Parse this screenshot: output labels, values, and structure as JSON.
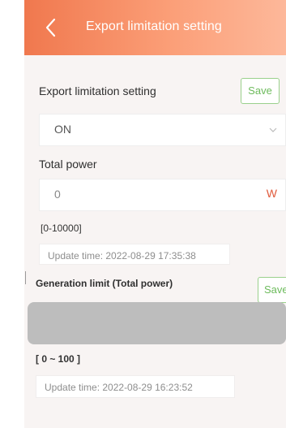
{
  "header": {
    "title": "Export limitation setting"
  },
  "export_section": {
    "label": "Export limitation setting",
    "save_label": "Save",
    "selected_value": "ON"
  },
  "power_section": {
    "label": "Total power",
    "value": "0",
    "unit": "W",
    "range": "[0-10000]",
    "update_text": "Update time:  2022-08-29 17:35:38"
  },
  "generation_section": {
    "label": "Generation limit (Total power)",
    "save_label": "Save",
    "range": "[ 0 ~ 100 ]",
    "update_text": "Update time:  2022-08-29 16:23:52"
  },
  "icons": {
    "back": "chevron-left-icon",
    "dropdown": "chevron-down-icon"
  },
  "colors": {
    "header_start": "#f0784e",
    "header_end": "#fdb89a",
    "save_green": "#6dbb5c",
    "unit_red": "#e05a3c",
    "background": "#f8f4f3"
  }
}
